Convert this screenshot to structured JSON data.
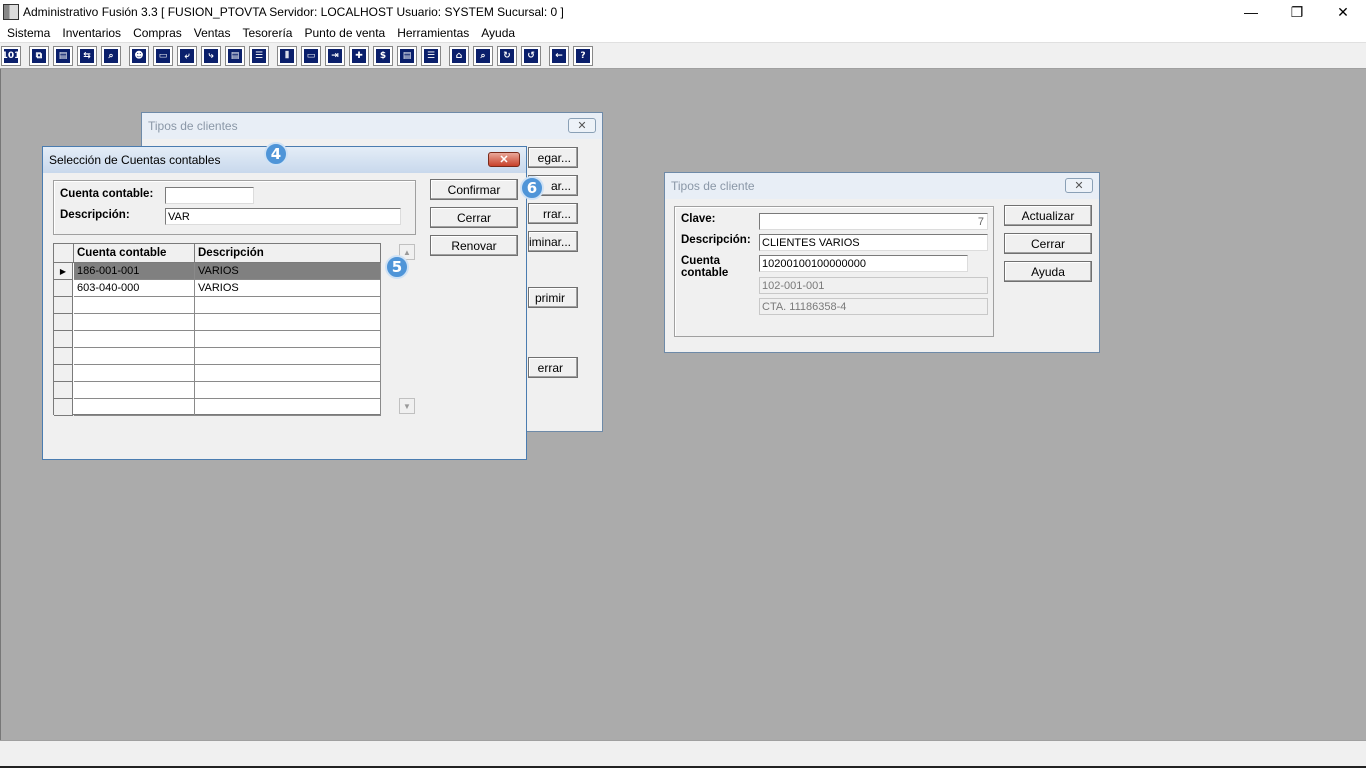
{
  "window": {
    "title": "Administrativo Fusión 3.3 [ FUSION_PTOVTA   Servidor: LOCALHOST   Usuario: SYSTEM     Sucursal: 0 ]",
    "minimize": "—",
    "restore": "❐",
    "close": "✕"
  },
  "menu": [
    "Sistema",
    "Inventarios",
    "Compras",
    "Ventas",
    "Tesorería",
    "Punto de venta",
    "Herramientas",
    "Ayuda"
  ],
  "toolbar_icons": [
    "101",
    "⧉",
    "▤",
    "⇆",
    "⌕",
    "☻",
    "▭",
    "⤶",
    "⤷",
    "▤",
    "☰",
    "⫴",
    "▭",
    "⇥",
    "✚",
    "$",
    "▤",
    "☰",
    "⌂",
    "⌕",
    "↻",
    "↺",
    "←",
    "?"
  ],
  "tipos_clientes_bg": {
    "title": "Tipos de clientes",
    "close_glyph": "✕",
    "buttons": [
      "egar...",
      "ar...",
      "rrar...",
      "iminar...",
      "primir",
      "errar"
    ]
  },
  "seleccion": {
    "title": "Selección de Cuentas contables",
    "close_glyph": "✕",
    "cuenta_label": "Cuenta contable:",
    "cuenta_value": "",
    "descripcion_label": "Descripción:",
    "descripcion_value": "VAR",
    "confirmar": "Confirmar",
    "cerrar": "Cerrar",
    "renovar": "Renovar",
    "col_cuenta": "Cuenta contable",
    "col_descripcion": "Descripción",
    "rows": [
      {
        "cuenta": "186-001-001",
        "descripcion": "VARIOS",
        "indicator": "▶"
      },
      {
        "cuenta": "603-040-000",
        "descripcion": "VARIOS",
        "indicator": ""
      }
    ],
    "scroll_up": "▲",
    "scroll_down": "▼"
  },
  "tipo_cliente": {
    "title": "Tipos de cliente",
    "close_glyph": "✕",
    "clave_label": "Clave:",
    "clave_value": "7",
    "descripcion_label": "Descripción:",
    "descripcion_value": "CLIENTES VARIOS",
    "cuenta_label_1": "Cuenta",
    "cuenta_label_2": "contable",
    "cuenta_value": "10200100100000000",
    "cuenta_ro_1": "102-001-001",
    "cuenta_ro_2": "CTA. 11186358-4",
    "actualizar": "Actualizar",
    "cerrar": "Cerrar",
    "ayuda": "Ayuda"
  },
  "badges": {
    "b4": "4",
    "b5": "5",
    "b6": "6"
  }
}
